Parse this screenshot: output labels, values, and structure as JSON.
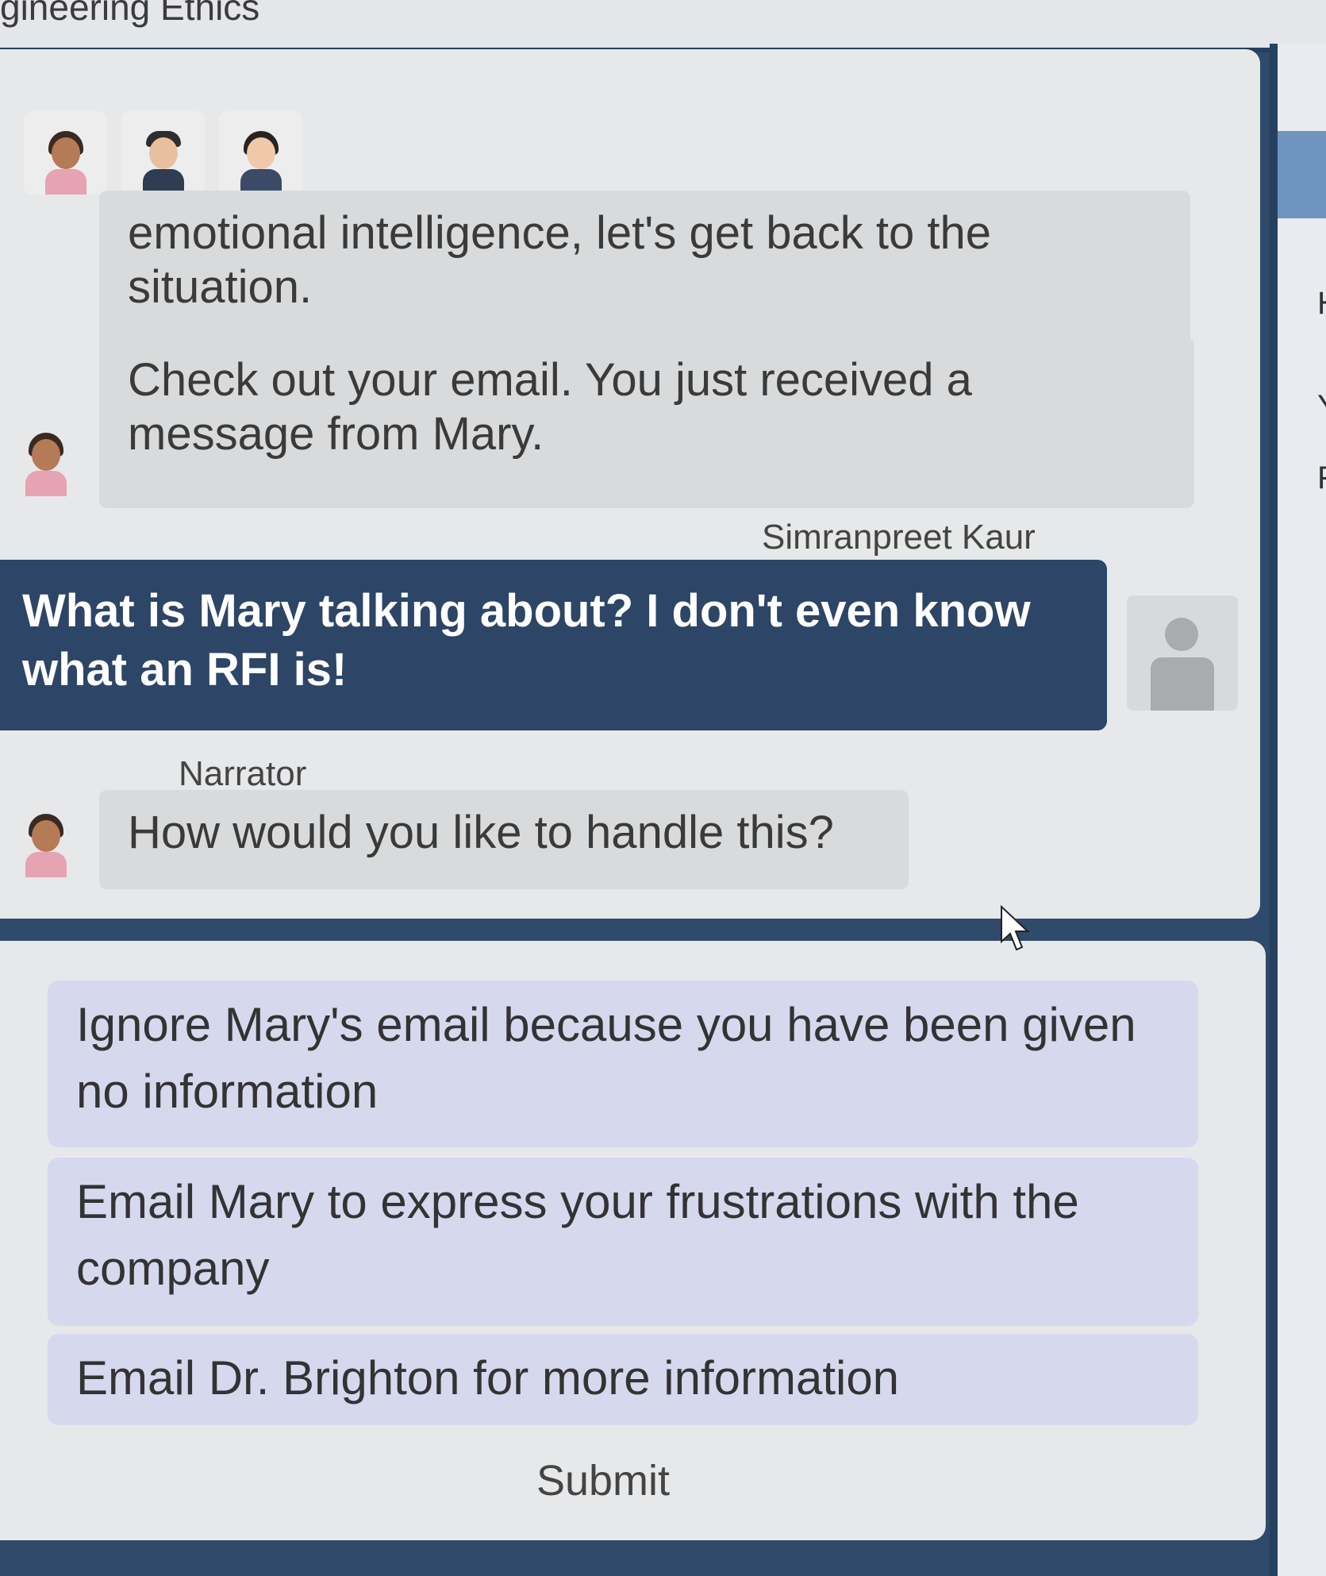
{
  "header": {
    "title": "gineering Ethics"
  },
  "right_panel": {
    "letters": [
      "H",
      "Y",
      "F"
    ]
  },
  "chat": {
    "messages": [
      {
        "text": "emotional intelligence, let's get back to the situation."
      },
      {
        "text": "Check out your email. You just received a message from Mary."
      }
    ],
    "user_speaker": "Simranpreet Kaur",
    "user_message": "What is Mary talking about? I don't even know what an RFI is!",
    "narrator_speaker": "Narrator",
    "narrator_message": "How would you like to handle this?"
  },
  "choices": {
    "options": [
      "Ignore Mary's email because you have been given no information",
      "Email Mary to express your frustrations with the company",
      "Email Dr. Brighton for more information"
    ],
    "submit_label": "Submit"
  }
}
